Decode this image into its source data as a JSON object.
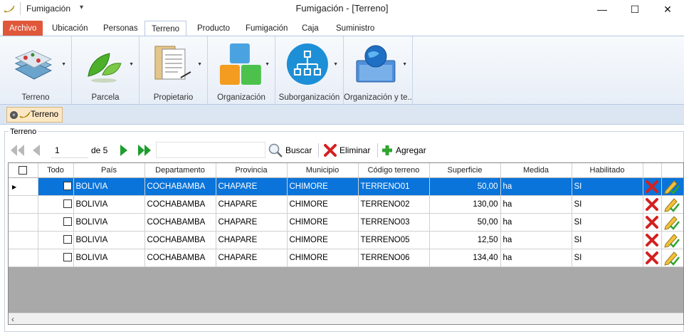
{
  "window": {
    "app_title": "Fumigación",
    "title": "Fumigación - [Terreno]",
    "minimize": "—",
    "maximize": "☐",
    "close": "✕"
  },
  "tabs": [
    "Archivo",
    "Ubicación",
    "Personas",
    "Terreno",
    "Producto",
    "Fumigación",
    "Caja",
    "Suministro"
  ],
  "active_tab": "Terreno",
  "ribbon": {
    "groups": [
      "Terreno",
      "Parcela",
      "Propietario",
      "Organización",
      "Suborganización",
      "Organización y te..."
    ]
  },
  "document_tab": "Terreno",
  "group_title": "Terreno",
  "navigator": {
    "position": "1",
    "of_label": "de 5",
    "search_value": "",
    "search_label": "Buscar",
    "delete_label": "Eliminar",
    "add_label": "Agregar"
  },
  "grid": {
    "columns": [
      "Todo",
      "País",
      "Departamento",
      "Provincia",
      "Municipio",
      "Código terreno",
      "Superficie",
      "Medida",
      "Habilitado"
    ],
    "rows": [
      {
        "pais": "BOLIVIA",
        "departamento": "COCHABAMBA",
        "provincia": "CHAPARE",
        "municipio": "CHIMORE",
        "codigo": "TERRENO01",
        "superficie": "50,00",
        "medida": "ha",
        "habilitado": "SI"
      },
      {
        "pais": "BOLIVIA",
        "departamento": "COCHABAMBA",
        "provincia": "CHAPARE",
        "municipio": "CHIMORE",
        "codigo": "TERRENO02",
        "superficie": "130,00",
        "medida": "ha",
        "habilitado": "SI"
      },
      {
        "pais": "BOLIVIA",
        "departamento": "COCHABAMBA",
        "provincia": "CHAPARE",
        "municipio": "CHIMORE",
        "codigo": "TERRENO03",
        "superficie": "50,00",
        "medida": "ha",
        "habilitado": "SI"
      },
      {
        "pais": "BOLIVIA",
        "departamento": "COCHABAMBA",
        "provincia": "CHAPARE",
        "municipio": "CHIMORE",
        "codigo": "TERRENO05",
        "superficie": "12,50",
        "medida": "ha",
        "habilitado": "SI"
      },
      {
        "pais": "BOLIVIA",
        "departamento": "COCHABAMBA",
        "provincia": "CHAPARE",
        "municipio": "CHIMORE",
        "codigo": "TERRENO06",
        "superficie": "134,40",
        "medida": "ha",
        "habilitado": "SI"
      }
    ],
    "selected_row": 0
  },
  "colors": {
    "accent": "#0a74da",
    "archivo_tab": "#e0573a",
    "delete_red": "#d42020",
    "nav_green": "#1e9e2e"
  }
}
